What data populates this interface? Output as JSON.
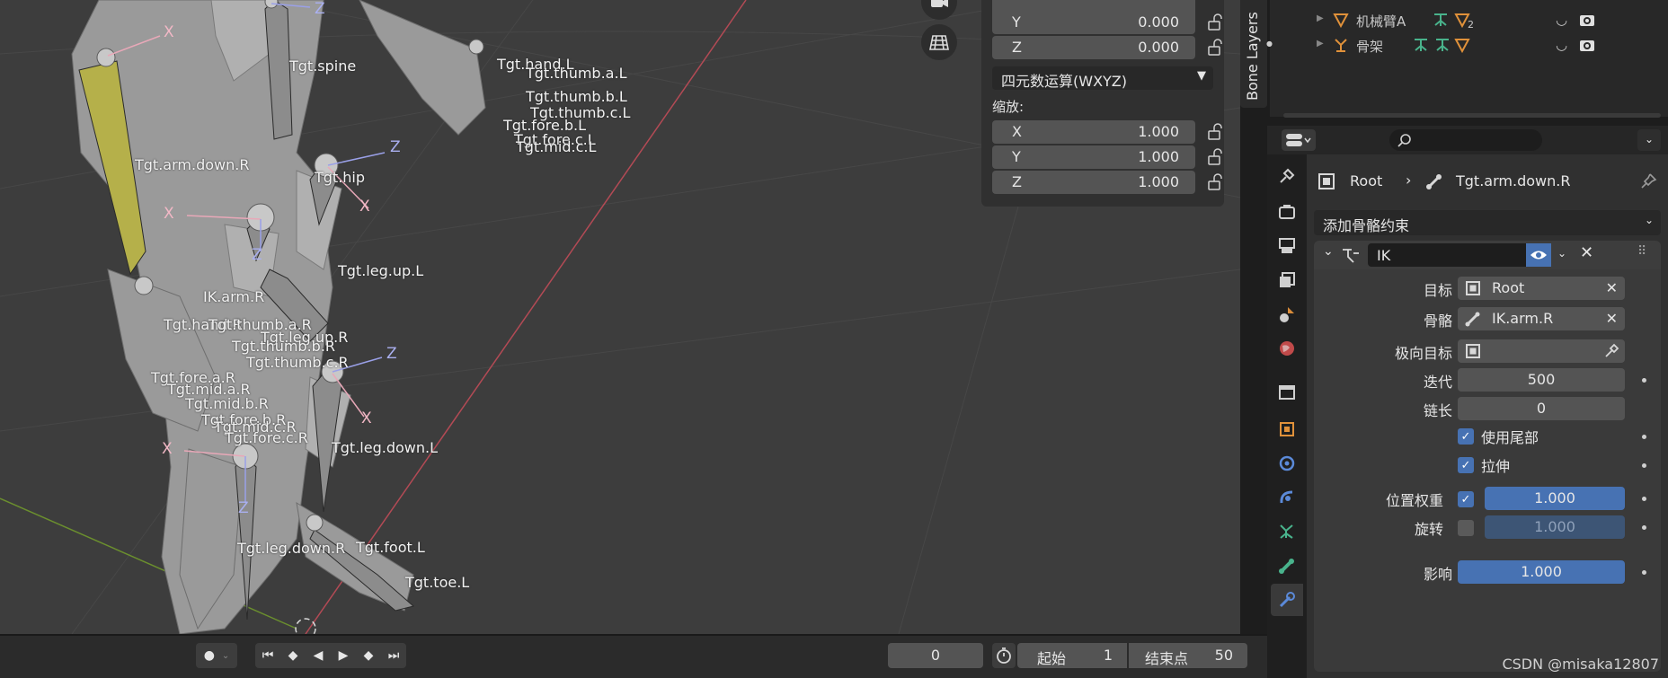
{
  "viewport": {
    "bone_labels": {
      "spine": "Tgt.spine",
      "hand_l": "Tgt.hand.L",
      "thumb_a_l": "Tgt.thumb.a.L",
      "thumb_b_l": "Tgt.thumb.b.L",
      "thumb_c_l": "Tgt.thumb.c.L",
      "fore_b_l": "Tgt.fore.b.L",
      "fore_c_l": "Tgt.fore.c.L",
      "mid_c_l": "Tgt.mid.c.L",
      "arm_down_r": "Tgt.arm.down.R",
      "hip": "Tgt.hip",
      "leg_up_l": "Tgt.leg.up.L",
      "ik_arm_r": "IK.arm.R",
      "hand_r": "Tgt.hand.R",
      "thumb_a_r": "Tgt.thumb.a.R",
      "leg_up_r": "Tgt.leg.up.R",
      "thumb_b_r": "Tgt.thumb.b.R",
      "thumb_c_r": "Tgt.thumb.c.R",
      "fore_a_r": "Tgt.fore.a.R",
      "mid_a_r": "Tgt.mid.a.R",
      "mid_b_r": "Tgt.mid.b.R",
      "fore_b_r": "Tgt.fore.b.R",
      "mid_c_r": "Tgt.mid.c.R",
      "fore_c_r": "Tgt.fore.c.R",
      "leg_down_l": "Tgt.leg.down.L",
      "leg_down_r": "Tgt.leg.down.R",
      "foot_l": "Tgt.foot.L",
      "toe_l": "Tgt.toe.L"
    },
    "axis_x": "X",
    "axis_z": "Z"
  },
  "npanel": {
    "rotation": [
      {
        "axis": "Y",
        "value": "0.000"
      },
      {
        "axis": "Z",
        "value": "0.000"
      }
    ],
    "rotation_mode": "四元数运算(WXYZ)",
    "scale_label": "缩放:",
    "scale": [
      {
        "axis": "X",
        "value": "1.000"
      },
      {
        "axis": "Y",
        "value": "1.000"
      },
      {
        "axis": "Z",
        "value": "1.000"
      }
    ]
  },
  "bone_layers_tab": "Bone Layers",
  "outliner": {
    "rows": [
      {
        "label": "机械臂A",
        "badge": "2"
      },
      {
        "label": "骨架"
      }
    ]
  },
  "properties": {
    "breadcrumb": {
      "object": "Root",
      "bone": "Tgt.arm.down.R"
    },
    "add_constraint": "添加骨骼约束",
    "constraint": {
      "name": "IK",
      "target_label": "目标",
      "target_value": "Root",
      "bone_label": "骨骼",
      "bone_value": "IK.arm.R",
      "pole_label": "极向目标",
      "iterations_label": "迭代",
      "iterations_value": "500",
      "chain_label": "链长",
      "chain_value": "0",
      "use_tail_label": "使用尾部",
      "stretch_label": "拉伸",
      "position_weight_label": "位置权重",
      "position_weight_value": "1.000",
      "rotation_label": "旋转",
      "rotation_value": "1.000",
      "influence_label": "影响",
      "influence_value": "1.000"
    }
  },
  "timeline": {
    "current_frame": "0",
    "start_label": "起始",
    "start_value": "1",
    "end_label": "结束点",
    "end_value": "50"
  },
  "watermark": "CSDN @misaka12807",
  "colors": {
    "accent_blue": "#4772b3",
    "viewport_bg": "#3d3d3d",
    "selected_bone": "#b5b04a"
  }
}
